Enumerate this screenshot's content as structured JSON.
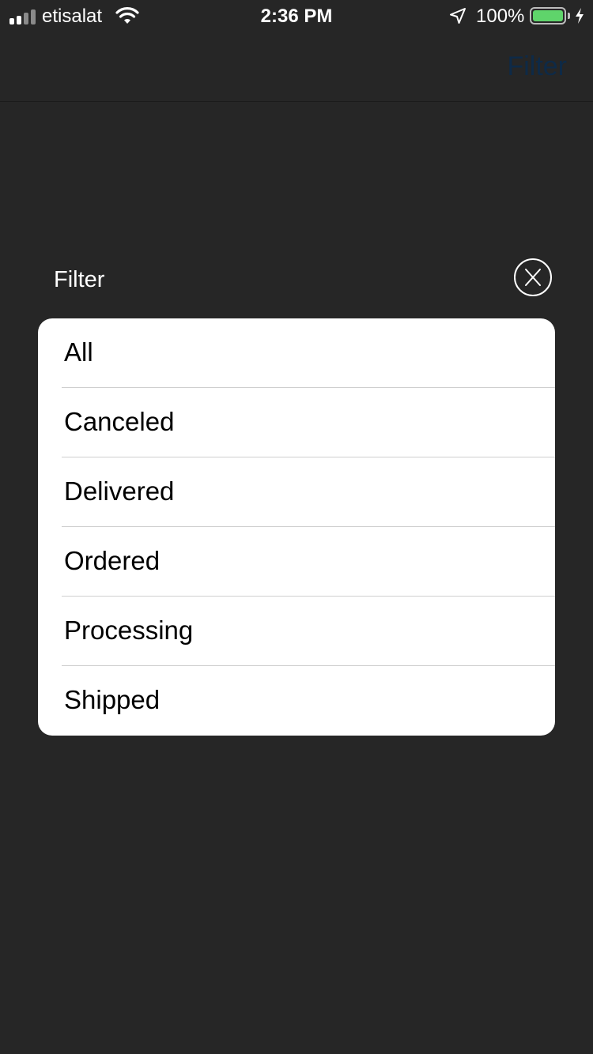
{
  "status_bar": {
    "carrier": "etisalat",
    "time": "2:36 PM",
    "battery_percent": "100%",
    "battery_level": 1.0,
    "battery_color": "#5fd46b",
    "icons": [
      "cellular-signal-icon",
      "wifi-icon",
      "location-arrow-icon",
      "battery-icon",
      "charging-bolt-icon"
    ]
  },
  "nav": {
    "filter_label": "Filter"
  },
  "modal": {
    "title": "Filter",
    "close_label": "X",
    "options": [
      {
        "label": "All"
      },
      {
        "label": "Canceled"
      },
      {
        "label": "Delivered"
      },
      {
        "label": "Ordered"
      },
      {
        "label": "Processing"
      },
      {
        "label": "Shipped"
      }
    ]
  },
  "colors": {
    "background": "#262626",
    "card": "#ffffff",
    "nav_filter": "#0e2a47"
  }
}
